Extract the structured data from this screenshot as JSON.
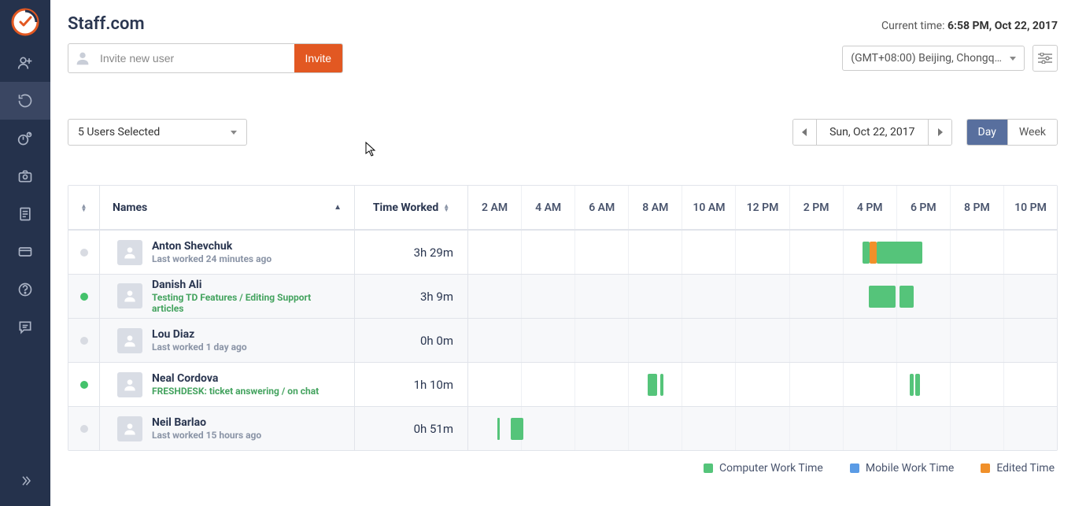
{
  "sidebar": {
    "icons": [
      "person-add-icon",
      "history-icon",
      "timer-icon",
      "camera-icon",
      "document-icon",
      "card-icon",
      "help-icon",
      "chat-icon"
    ],
    "active_index": 1,
    "expand_icon": "chevrons-right-icon"
  },
  "header": {
    "title": "Staff.com",
    "current_time_label": "Current time:",
    "current_time_value": "6:58 PM, Oct 22, 2017"
  },
  "invite": {
    "placeholder": "Invite new user",
    "button": "Invite"
  },
  "timezone": {
    "label": "(GMT+08:00) Beijing, Chongq…"
  },
  "users_select": {
    "label": "5 Users Selected"
  },
  "date_picker": {
    "label": "Sun, Oct 22, 2017"
  },
  "view_toggle": {
    "day": "Day",
    "week": "Week",
    "active": "Day"
  },
  "table": {
    "headers": {
      "names": "Names",
      "time_worked": "Time Worked"
    },
    "hours": [
      "2 AM",
      "4 AM",
      "6 AM",
      "8 AM",
      "10 AM",
      "12 PM",
      "2 PM",
      "4 PM",
      "6 PM",
      "8 PM",
      "10 PM"
    ],
    "timeline_start_hour": 1,
    "timeline_end_hour": 23
  },
  "rows": [
    {
      "status": "grey",
      "name": "Anton Shevchuk",
      "sub": "Last worked 24 minutes ago",
      "sub_green": false,
      "time": "3h 29m",
      "alt": false,
      "bars": [
        {
          "type": "green",
          "start_pct": 67.0,
          "width_pct": 1.2
        },
        {
          "type": "orange",
          "start_pct": 68.2,
          "width_pct": 1.2
        },
        {
          "type": "green",
          "start_pct": 69.4,
          "width_pct": 7.8
        }
      ]
    },
    {
      "status": "green",
      "name": "Danish Ali",
      "sub": "Testing TD Features / Editing Support articles",
      "sub_green": true,
      "time": "3h 9m",
      "alt": true,
      "bars": [
        {
          "type": "green",
          "start_pct": 68.0,
          "width_pct": 4.6
        },
        {
          "type": "green",
          "start_pct": 73.2,
          "width_pct": 2.5
        }
      ]
    },
    {
      "status": "grey",
      "name": "Lou Diaz",
      "sub": "Last worked 1 day ago",
      "sub_green": false,
      "time": "0h 0m",
      "alt": true,
      "bars": []
    },
    {
      "status": "green",
      "name": "Neal Cordova",
      "sub": "FRESHDESK: ticket answering / on chat",
      "sub_green": true,
      "time": "1h 10m",
      "alt": false,
      "bars": [
        {
          "type": "green",
          "start_pct": 30.5,
          "width_pct": 1.6
        },
        {
          "type": "green",
          "start_pct": 32.6,
          "width_pct": 0.6
        },
        {
          "type": "green",
          "start_pct": 75.0,
          "width_pct": 0.7
        },
        {
          "type": "green",
          "start_pct": 76.0,
          "width_pct": 0.7
        }
      ]
    },
    {
      "status": "grey",
      "name": "Neil Barlao",
      "sub": "Last worked 15 hours ago",
      "sub_green": false,
      "time": "0h 51m",
      "alt": true,
      "bars": [
        {
          "type": "thin",
          "start_pct": 5.0,
          "width_pct": 0.3
        },
        {
          "type": "green",
          "start_pct": 7.2,
          "width_pct": 2.2
        }
      ]
    }
  ],
  "legend": {
    "computer": "Computer Work Time",
    "mobile": "Mobile Work Time",
    "edited": "Edited Time"
  }
}
